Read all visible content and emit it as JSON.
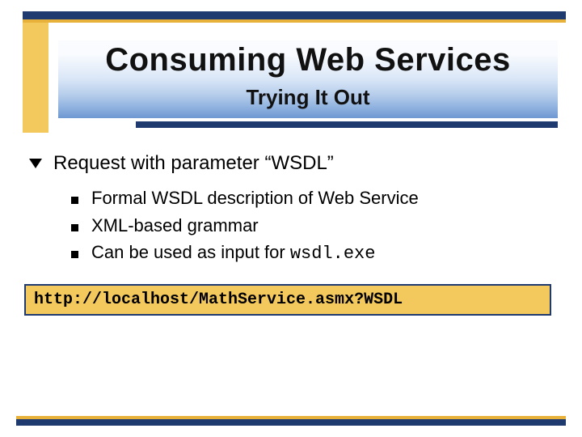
{
  "header": {
    "title": "Consuming Web Services",
    "subtitle": "Trying It Out"
  },
  "body": {
    "main_point": "Request with parameter “WSDL”",
    "sub_points": [
      "Formal WSDL description of Web Service",
      "XML-based grammar",
      "Can be used as input for "
    ],
    "sub_point_3_code": "wsdl.exe"
  },
  "codebox": {
    "text": "http://localhost/MathService.asmx?WSDL"
  }
}
